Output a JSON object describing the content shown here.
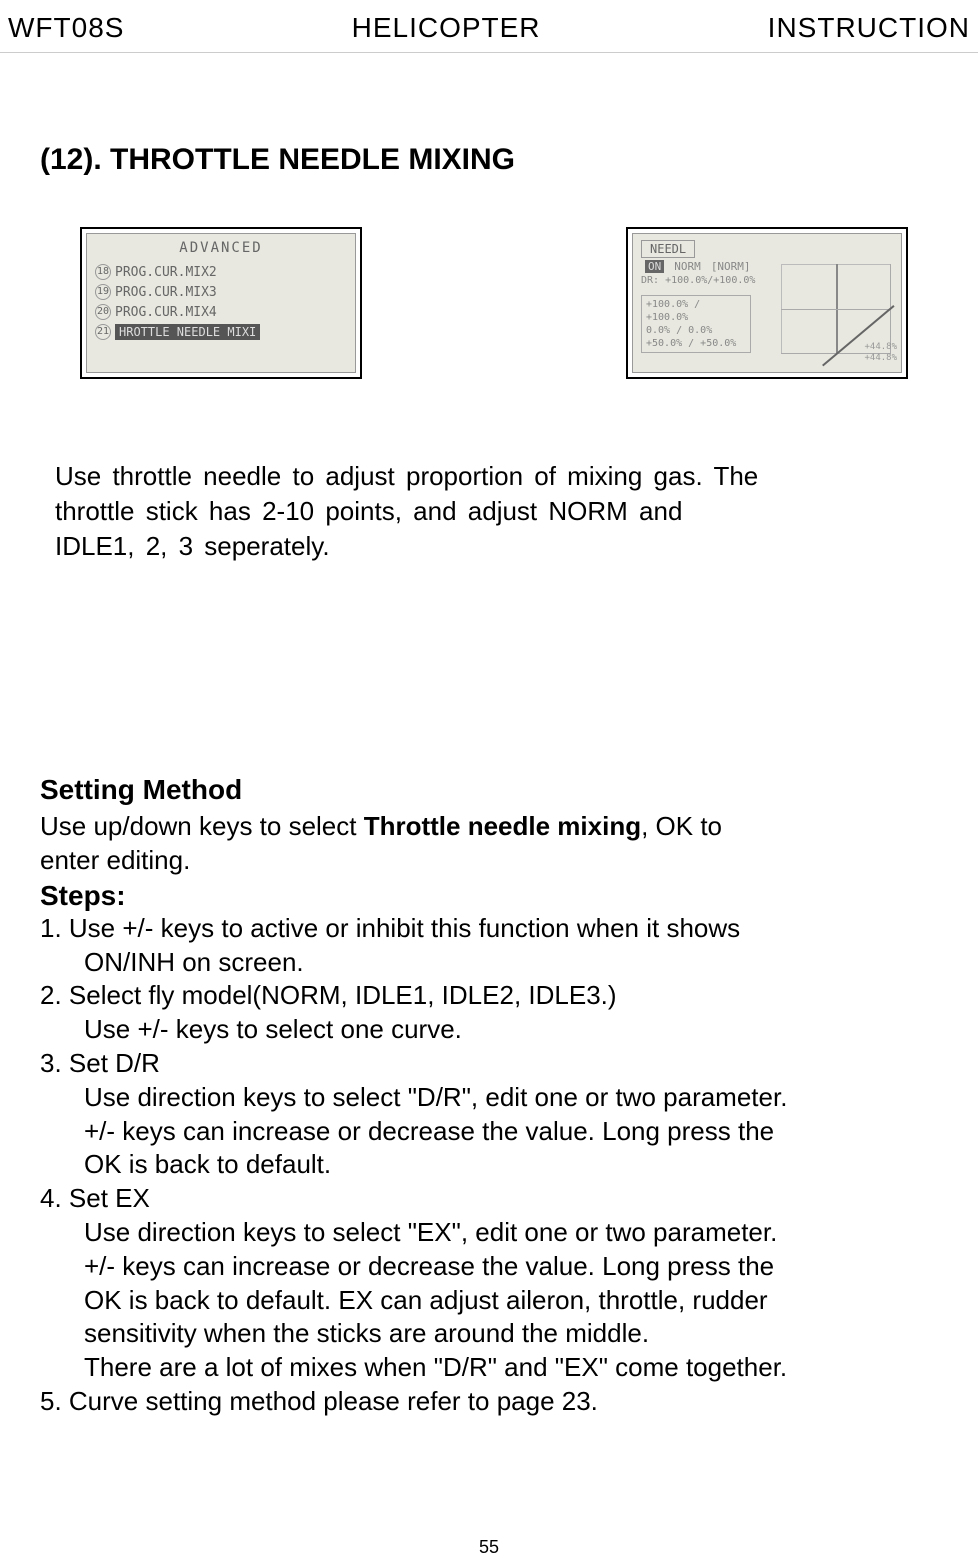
{
  "header": {
    "left": "WFT08S",
    "center": "HELICOPTER",
    "right": "INSTRUCTION"
  },
  "section_title": "(12). THROTTLE NEEDLE MIXING",
  "figure1": {
    "title": "ADVANCED",
    "items": [
      {
        "num": "18",
        "label": "PROG.CUR.MIX2"
      },
      {
        "num": "19",
        "label": "PROG.CUR.MIX3"
      },
      {
        "num": "20",
        "label": "PROG.CUR.MIX4"
      }
    ],
    "highlighted_num": "21",
    "highlighted": "HROTTLE NEEDLE MIXI"
  },
  "figure2": {
    "title": "NEEDL",
    "mode_label": "ON",
    "mode_value": "NORM",
    "mode_bracket": "[NORM]",
    "dr_label": "DR:",
    "dr_value": "+100.0%/+100.0%",
    "box_lines": [
      "+100.0% / +100.0%",
      "0.0%    / 0.0%",
      "+50.0% / +50.0%"
    ],
    "side_values": [
      "+44.8%",
      "+44.8%"
    ]
  },
  "intro": {
    "line1": "Use throttle needle to adjust proportion of mixing gas. The",
    "line2": "throttle stick has 2-10 points, and adjust NORM and",
    "line3": "IDLE1, 2, 3 seperately."
  },
  "setting": {
    "heading": "Setting Method",
    "intro_a": "Use up/down keys to select ",
    "intro_bold": "Throttle needle mixing",
    "intro_b": ", OK to",
    "intro_c": "enter editing.",
    "steps_heading": "Steps:",
    "steps": {
      "s1": "1. Use +/- keys to active or inhibit this function when it shows",
      "s1b": "ON/INH on screen.",
      "s2": "2. Select fly model(NORM, IDLE1, IDLE2, IDLE3.)",
      "s2b": "Use +/- keys to select one curve.",
      "s3": "3. Set D/R",
      "s3b": "Use direction keys to select \"D/R\", edit one or two parameter.",
      "s3c": "+/- keys can increase or decrease the value. Long press the",
      "s3d": "OK is back to default.",
      "s4": "4. Set EX",
      "s4b": "Use direction keys to select \"EX\", edit one or two parameter.",
      "s4c": "+/- keys can increase or decrease the value. Long press the",
      "s4d": "OK is back to default. EX can adjust aileron, throttle, rudder",
      "s4e": "sensitivity when the  sticks are around the middle.",
      "s4f": "There are a lot of mixes when \"D/R\" and \"EX\" come together.",
      "s5": "5. Curve setting method please refer to page 23."
    }
  },
  "page_number": "55"
}
